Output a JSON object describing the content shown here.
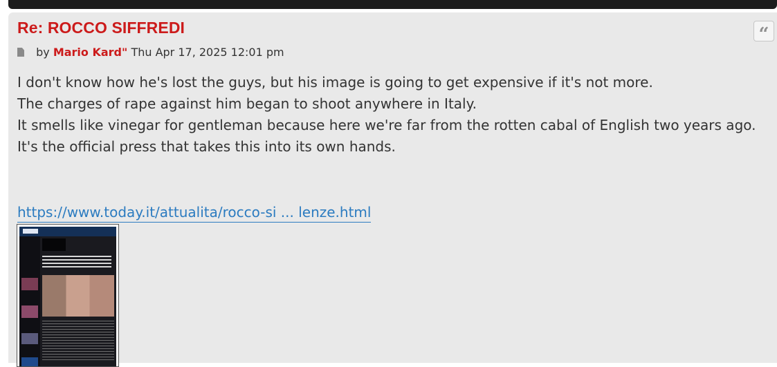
{
  "post": {
    "title": "Re: ROCCO SIFFREDI",
    "by_label": "by",
    "author": "Mario Kard\"",
    "timestamp": "Thu Apr 17, 2025 12:01 pm",
    "quote_icon": "quote-icon",
    "post_icon": "file-icon",
    "lines": [
      "I don't know how he's lost the guys, but his image is going to get expensive if it's not more.",
      "The charges of rape against him began to shoot anywhere in Italy.",
      "It smells like vinegar for gentleman because here we're far from the rotten cabal of English two years ago.",
      "It's the official press that takes this into its own hands."
    ],
    "link_text": "https://www.today.it/attualita/rocco-si ... lenze.html"
  },
  "colors": {
    "accent_red": "#cc1b1b",
    "link_blue": "#2b7bc0",
    "panel_bg": "#e9e9e9"
  }
}
